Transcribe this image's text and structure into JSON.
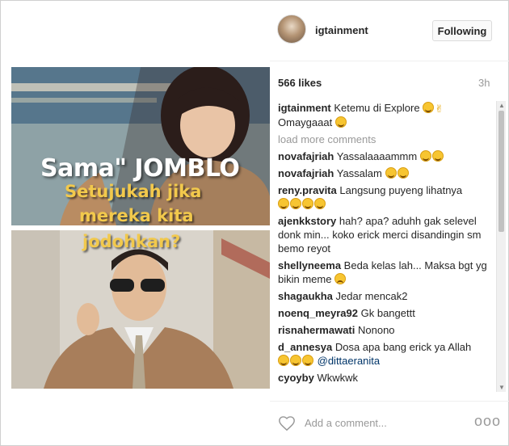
{
  "header": {
    "username": "igtainment",
    "follow_label": "Following"
  },
  "post": {
    "likes": "566 likes",
    "time": "3h",
    "image_caption": {
      "line1": "Sama\" JOMBLO",
      "line2": "Setujukah jika",
      "line3": "mereka kita",
      "line4": "jodohkan?"
    }
  },
  "caption": {
    "user": "igtainment",
    "text": "Ketemu di Explore",
    "text2": "Omaygaaat"
  },
  "load_more": "load more comments",
  "comments": [
    {
      "user": "novafajriah",
      "text": "Yassalaaaammm"
    },
    {
      "user": "novafajriah",
      "text": "Yassalam"
    },
    {
      "user": "reny.pravita",
      "text": "Langsung puyeng lihatnya"
    },
    {
      "user": "ajenkkstory",
      "text": "hah? apa? aduhh gak selevel donk min... koko erick merci disandingin sm bemo reyot"
    },
    {
      "user": "shellyneema",
      "text": "Beda kelas lah... Maksa bgt yg bikin meme"
    },
    {
      "user": "shagaukha",
      "text": "Jedar mencak2"
    },
    {
      "user": "noenq_meyra92",
      "text": "Gk bangettt"
    },
    {
      "user": "risnahermawati",
      "text": "Nonono"
    },
    {
      "user": "d_annesya",
      "text": "Dosa apa bang erick ya Allah",
      "mention": "@dittaeranita"
    },
    {
      "user": "cyoyby",
      "text": "Wkwkwk"
    }
  ],
  "footer": {
    "add_comment_placeholder": "Add a comment...",
    "more_label": "ooo"
  },
  "icons": [
    "heart-icon",
    "more-options-icon",
    "scroll-up-icon",
    "scroll-down-icon"
  ]
}
